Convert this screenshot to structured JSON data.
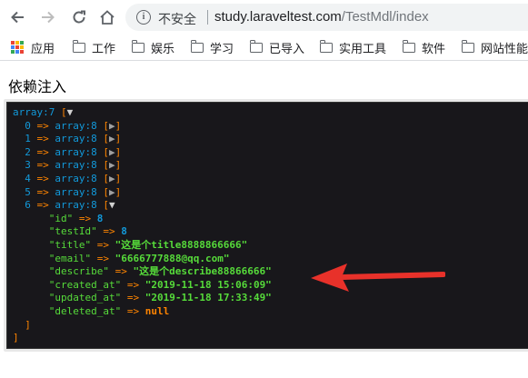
{
  "browser": {
    "insecure_label": "不安全",
    "url_host": "study.laraveltest.com",
    "url_path": "/TestMdl/index"
  },
  "bookmarks": [
    {
      "label": "应用",
      "icon": "apps-grid-icon"
    },
    {
      "label": "工作",
      "icon": "folder-icon"
    },
    {
      "label": "娱乐",
      "icon": "folder-icon"
    },
    {
      "label": "学习",
      "icon": "folder-icon"
    },
    {
      "label": "已导入",
      "icon": "folder-icon"
    },
    {
      "label": "实用工具",
      "icon": "folder-icon"
    },
    {
      "label": "软件",
      "icon": "folder-icon"
    },
    {
      "label": "网站性能",
      "icon": "folder-icon"
    }
  ],
  "page": {
    "title": "依赖注入"
  },
  "dump": {
    "root_type": "array:7",
    "open_bracket": "[",
    "close_bracket": "]",
    "arrow": "=>",
    "collapsed_toggle": "▶",
    "expanded_toggle": "▼",
    "items": [
      {
        "index": "0",
        "type": "array:8"
      },
      {
        "index": "1",
        "type": "array:8"
      },
      {
        "index": "2",
        "type": "array:8"
      },
      {
        "index": "3",
        "type": "array:8"
      },
      {
        "index": "4",
        "type": "array:8"
      },
      {
        "index": "5",
        "type": "array:8"
      },
      {
        "index": "6",
        "type": "array:8"
      }
    ],
    "fields": [
      {
        "key": "\"id\"",
        "value": "8",
        "kind": "num"
      },
      {
        "key": "\"testId\"",
        "value": "8",
        "kind": "num"
      },
      {
        "key": "\"title\"",
        "value": "\"这是个title8888866666\"",
        "kind": "str"
      },
      {
        "key": "\"email\"",
        "value": "\"6666777888@qq.com\"",
        "kind": "str"
      },
      {
        "key": "\"describe\"",
        "value": "\"这是个describe88866666\"",
        "kind": "str"
      },
      {
        "key": "\"created_at\"",
        "value": "\"2019-11-18 15:06:09\"",
        "kind": "str"
      },
      {
        "key": "\"updated_at\"",
        "value": "\"2019-11-18 17:33:49\"",
        "kind": "str"
      },
      {
        "key": "\"deleted_at\"",
        "value": "null",
        "kind": "null"
      }
    ]
  },
  "colors": {
    "dump_bg": "#18171b",
    "dump_key": "#56db3a",
    "dump_type": "#1299da",
    "dump_arrow": "#ff8400",
    "annotation_arrow": "#e8312a"
  }
}
